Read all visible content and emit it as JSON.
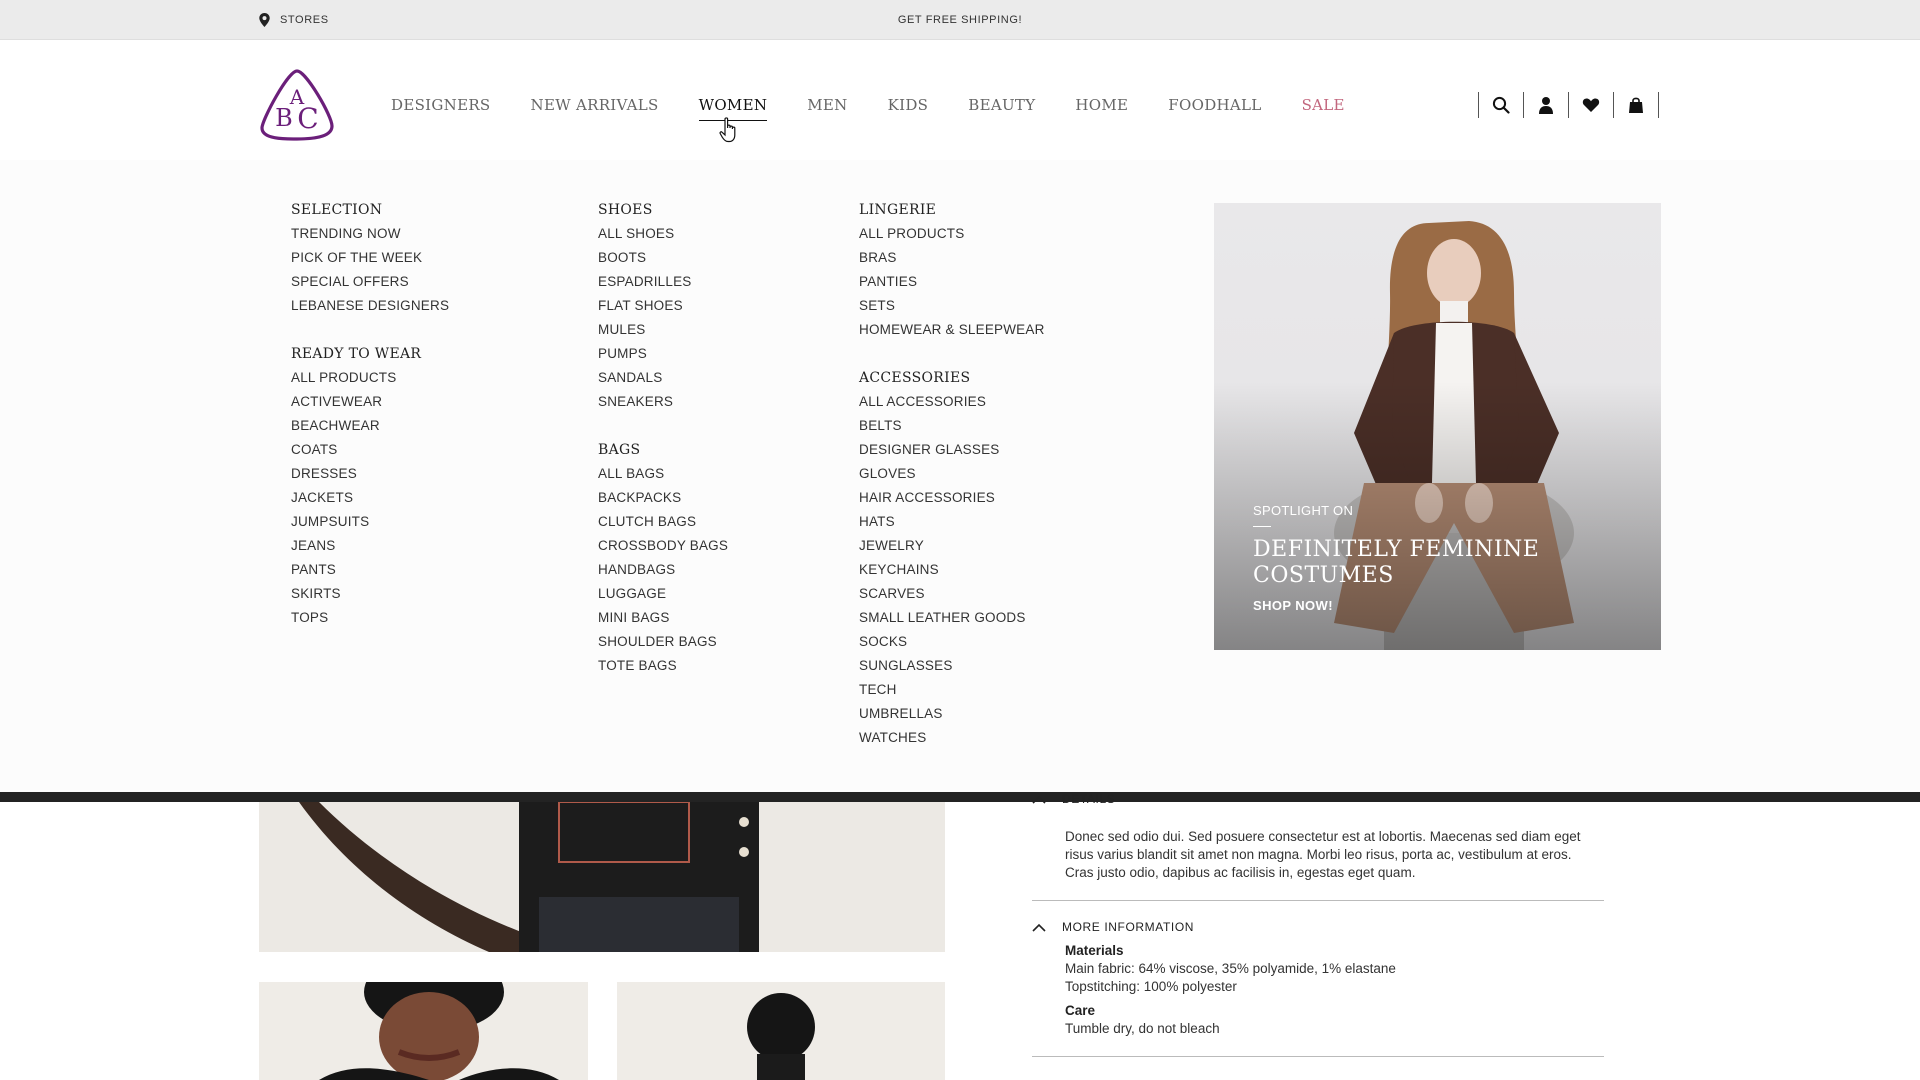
{
  "topbar": {
    "stores_label": "STORES",
    "shipping_label": "GET FREE SHIPPING!"
  },
  "header": {
    "logo_text": "ABC",
    "nav": [
      {
        "label": "DESIGNERS"
      },
      {
        "label": "NEW ARRIVALS"
      },
      {
        "label": "WOMEN",
        "active": true
      },
      {
        "label": "MEN"
      },
      {
        "label": "KIDS"
      },
      {
        "label": "BEAUTY"
      },
      {
        "label": "HOME"
      },
      {
        "label": "FOODHALL"
      },
      {
        "label": "SALE",
        "accent": "#c2667d"
      }
    ],
    "icons": [
      "search-icon",
      "user-icon",
      "heart-icon",
      "shopping-bag-icon"
    ]
  },
  "mega": {
    "col1": {
      "selection": {
        "title": "SELECTION",
        "links": [
          "TRENDING NOW",
          "PICK OF THE WEEK",
          "SPECIAL OFFERS",
          "LEBANESE DESIGNERS"
        ]
      },
      "rtw": {
        "title": "READY TO WEAR",
        "links": [
          "ALL PRODUCTS",
          "ACTIVEWEAR",
          "BEACHWEAR",
          "COATS",
          "DRESSES",
          "JACKETS",
          "JUMPSUITS",
          "JEANS",
          "PANTS",
          "SKIRTS",
          "TOPS"
        ]
      }
    },
    "col2": {
      "shoes": {
        "title": "SHOES",
        "links": [
          "ALL SHOES",
          "BOOTS",
          "ESPADRILLES",
          "FLAT SHOES",
          "MULES",
          "PUMPS",
          "SANDALS",
          "SNEAKERS"
        ]
      },
      "bags": {
        "title": "BAGS",
        "links": [
          "ALL BAGS",
          "BACKPACKS",
          "CLUTCH BAGS",
          "CROSSBODY BAGS",
          "HANDBAGS",
          "LUGGAGE",
          "MINI BAGS",
          "SHOULDER BAGS",
          "TOTE BAGS"
        ]
      }
    },
    "col3": {
      "lingerie": {
        "title": "LINGERIE",
        "links": [
          "ALL PRODUCTS",
          "BRAS",
          "PANTIES",
          "SETS",
          "HOMEWEAR & SLEEPWEAR"
        ]
      },
      "accessories": {
        "title": "ACCESSORIES",
        "links": [
          "ALL ACCESSORIES",
          "BELTS",
          "DESIGNER GLASSES",
          "GLOVES",
          "HAIR ACCESSORIES",
          "HATS",
          "JEWELRY",
          "KEYCHAINS",
          "SCARVES",
          "SMALL LEATHER GOODS",
          "SOCKS",
          "SUNGLASSES",
          "TECH",
          "UMBRELLAS",
          "WATCHES"
        ]
      }
    },
    "promo": {
      "kicker": "SPOTLIGHT ON",
      "title": "DEFINITELY FEMININE COSTUMES",
      "cta": "SHOP NOW!"
    }
  },
  "product": {
    "details_label": "DETAILS",
    "description": "Donec sed odio dui. Sed posuere consectetur est at lobortis. Maecenas sed diam eget risus varius blandit sit amet non magna. Morbi leo risus, porta ac, vestibulum at eros. Cras justo odio, dapibus ac facilisis in, egestas eget quam.",
    "more_info_label": "MORE INFORMATION",
    "materials_label": "Materials",
    "materials_line1": "Main fabric: 64% viscose, 35% polyamide, 1% elastane",
    "materials_line2": "Topstitching: 100% polyester",
    "care_label": "Care",
    "care_text": "Tumble dry, do not bleach"
  },
  "colors": {
    "brand": "#6b1f7a",
    "sale": "#c2667d",
    "topbar_bg": "#ebebeb"
  }
}
